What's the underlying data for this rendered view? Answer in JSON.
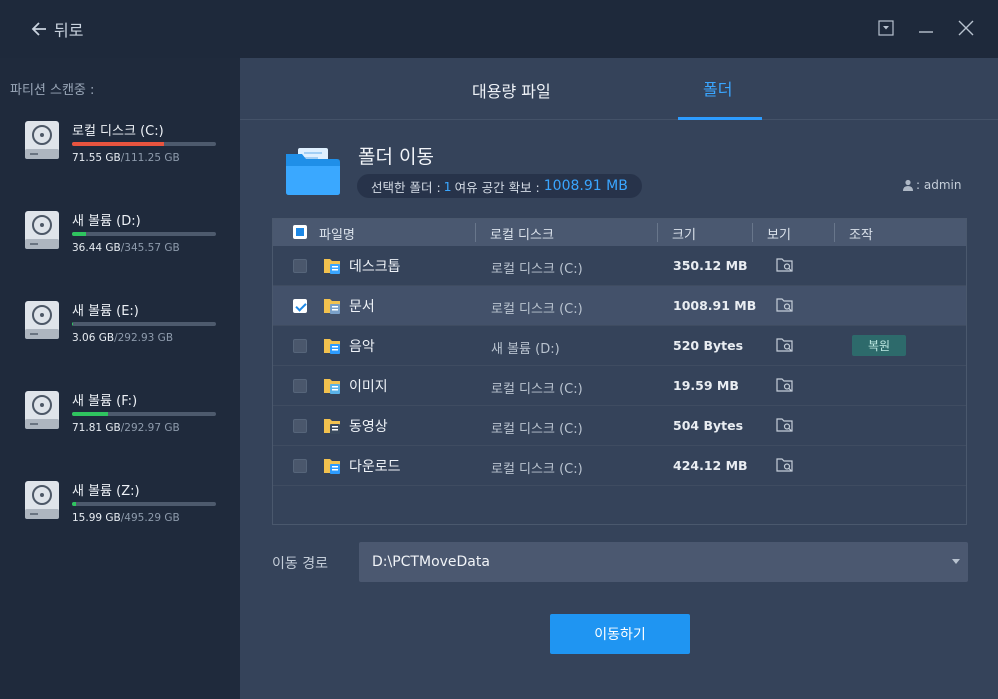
{
  "titlebar": {
    "back_label": "뒤로",
    "controls": [
      "dropdown-icon",
      "minimize-icon",
      "close-icon"
    ]
  },
  "sidebar": {
    "title": "파티션 스캔중 :",
    "drives": [
      {
        "name": "로컬 디스크 (C:)",
        "used": "71.55 GB",
        "total": "/111.25 GB",
        "fill": 0.64,
        "color": "#e8543f"
      },
      {
        "name": "새 볼륨 (D:)",
        "used": "36.44 GB",
        "total": "/345.57 GB",
        "fill": 0.1,
        "color": "#2fc45f"
      },
      {
        "name": "새 볼륨 (E:)",
        "used": "3.06 GB",
        "total": "/292.93 GB",
        "fill": 0.01,
        "color": "#2fc45f"
      },
      {
        "name": "새 볼륨 (F:)",
        "used": "71.81 GB",
        "total": "/292.97 GB",
        "fill": 0.25,
        "color": "#2fc45f"
      },
      {
        "name": "새 볼륨 (Z:)",
        "used": "15.99 GB",
        "total": "/495.29 GB",
        "fill": 0.03,
        "color": "#2fc45f"
      }
    ]
  },
  "tabs": {
    "files": "대용량 파일",
    "folder": "폴더",
    "active": "folder"
  },
  "header": {
    "title": "폴더 이동",
    "selected_prefix": "선택한 폴더 :",
    "selected_count": "1",
    "space_prefix": "여유 공간 확보 :",
    "space_value": "1008.91 MB",
    "user": ": admin"
  },
  "table": {
    "columns": [
      "파일명",
      "로컬 디스크",
      "크기",
      "보기",
      "조작"
    ],
    "rows": [
      {
        "name": "데스크톱",
        "location": "로컬 디스크 (C:)",
        "size": "350.12 MB",
        "checked": false,
        "selected": false,
        "icon": "desktop-folder-icon",
        "action": ""
      },
      {
        "name": "문서",
        "location": "로컬 디스크 (C:)",
        "size": "1008.91 MB",
        "checked": true,
        "selected": true,
        "icon": "documents-folder-icon",
        "action": ""
      },
      {
        "name": "음악",
        "location": "새 볼륨 (D:)",
        "size": "520 Bytes",
        "checked": false,
        "selected": false,
        "icon": "music-folder-icon",
        "action": "복원"
      },
      {
        "name": "이미지",
        "location": "로컬 디스크 (C:)",
        "size": "19.59 MB",
        "checked": false,
        "selected": false,
        "icon": "pictures-folder-icon",
        "action": ""
      },
      {
        "name": "동영상",
        "location": "로컬 디스크 (C:)",
        "size": "504 Bytes",
        "checked": false,
        "selected": false,
        "icon": "videos-folder-icon",
        "action": ""
      },
      {
        "name": "다운로드",
        "location": "로컬 디스크 (C:)",
        "size": "424.12 MB",
        "checked": false,
        "selected": false,
        "icon": "downloads-folder-icon",
        "action": ""
      }
    ]
  },
  "path": {
    "label": "이동 경로",
    "value": "D:\\PCTMoveData"
  },
  "move_button": "이동하기",
  "colors": {
    "accent": "#1f95f2",
    "sidebar_bg": "#1f2a3c",
    "main_bg": "#35435a",
    "restore_bg": "#2d6a6b"
  }
}
